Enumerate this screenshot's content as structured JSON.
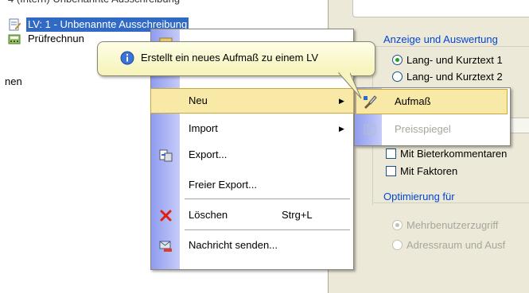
{
  "tree": {
    "cut_row": "4 (Intern) Unbenannte Ausschreibung",
    "lv_row": "LV: 1 - Unbenannte Ausschreibung",
    "pruef_row": "Prüfrechnun",
    "nen_row": "nen"
  },
  "panel": {
    "group_display": "Anzeige und Auswertung",
    "radio_lang1": "Lang- und Kurztext 1",
    "radio_lang2": "Lang- und Kurztext 2",
    "check_bieter": "Mit Bieterkommentaren",
    "check_faktoren": "Mit Faktoren",
    "group_opt": "Optimierung für",
    "radio_mehr": "Mehrbenutzerzugriff",
    "radio_adress": "Adressraum und Ausf"
  },
  "menu": {
    "neu": "Neu",
    "import": "Import",
    "export": "Export...",
    "freier_export": "Freier Export...",
    "loeschen": "Löschen",
    "loeschen_shortcut": "Strg+L",
    "nachricht": "Nachricht senden..."
  },
  "submenu": {
    "aufmass": "Aufmaß",
    "preisspiegel": "Preisspiegel"
  },
  "tooltip": {
    "text": "Erstellt ein neues Aufmaß zu einem LV"
  },
  "colors": {
    "selection": "#316ac5",
    "menu_highlight": "#f8e9a6",
    "group_title": "#0046d5"
  }
}
